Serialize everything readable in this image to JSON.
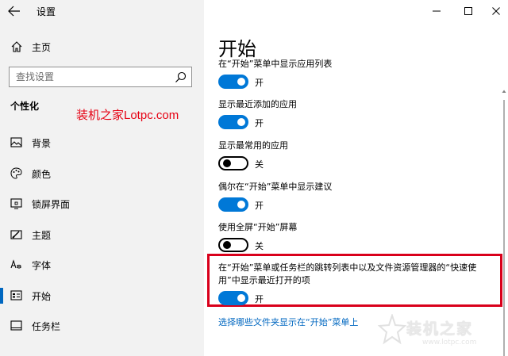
{
  "window": {
    "title": "设置"
  },
  "sidebar": {
    "home_label": "主页",
    "search_placeholder": "查找设置",
    "section_title": "个性化",
    "watermark": "装机之家Lotpc.com",
    "items": [
      {
        "label": "背景",
        "icon": "image-icon"
      },
      {
        "label": "颜色",
        "icon": "palette-icon"
      },
      {
        "label": "锁屏界面",
        "icon": "lockscreen-icon"
      },
      {
        "label": "主题",
        "icon": "theme-brush-icon"
      },
      {
        "label": "字体",
        "icon": "font-icon"
      },
      {
        "label": "开始",
        "icon": "start-icon",
        "active": true
      },
      {
        "label": "任务栏",
        "icon": "taskbar-icon"
      }
    ]
  },
  "main": {
    "title": "开始",
    "settings": [
      {
        "label": "在“开始”菜单中显示应用列表",
        "state": "开",
        "on": true
      },
      {
        "label": "显示最近添加的应用",
        "state": "开",
        "on": true
      },
      {
        "label": "显示最常用的应用",
        "state": "关",
        "on": false
      },
      {
        "label": "偶尔在“开始”菜单中显示建议",
        "state": "开",
        "on": true
      },
      {
        "label": "使用全屏“开始”屏幕",
        "state": "关",
        "on": false
      },
      {
        "label": "在“开始”菜单或任务栏的跳转列表中以及文件资源管理器的“快速使用”中显示最近打开的项",
        "state": "开",
        "on": true
      }
    ],
    "link": "选择哪些文件夹显示在“开始”菜单上"
  },
  "brand_watermark": {
    "text": "装机之家",
    "url": "www.lotpc.com"
  },
  "colors": {
    "accent": "#0078d7",
    "highlight": "#d9001b",
    "sidebar_bg": "#f2f2f2"
  }
}
